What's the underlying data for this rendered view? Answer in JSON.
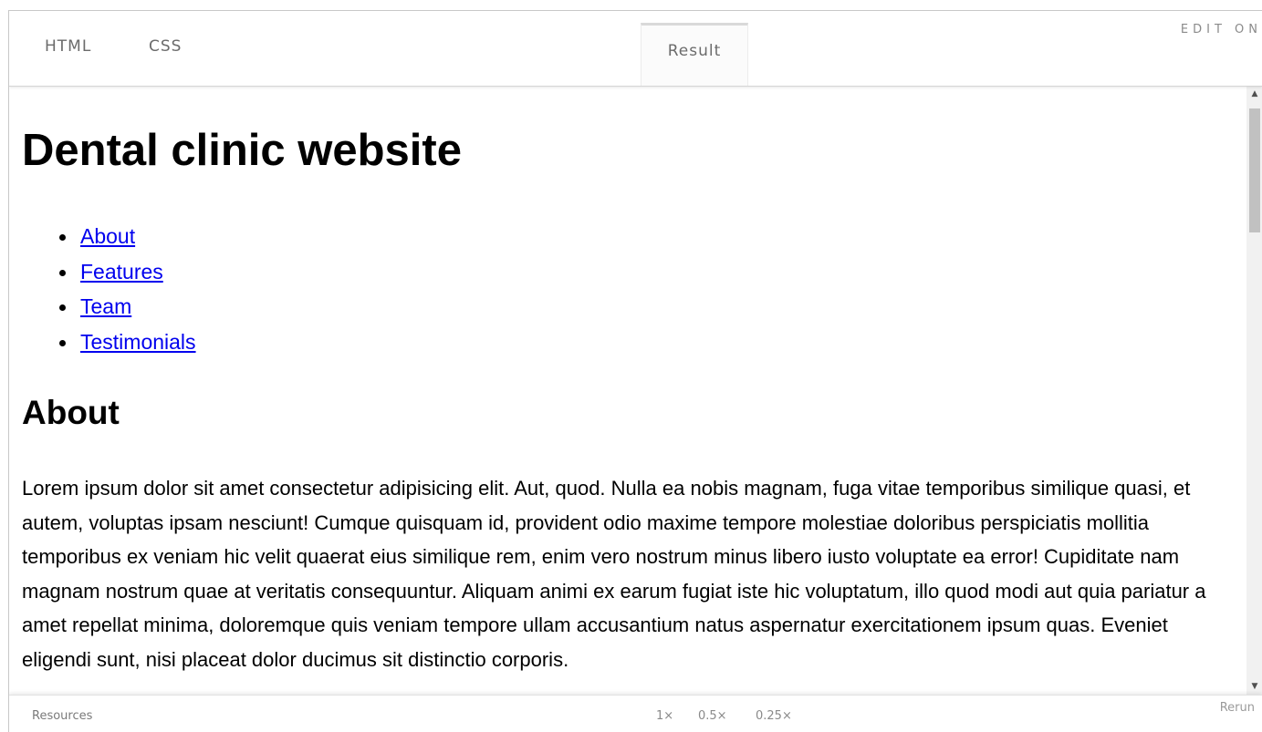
{
  "tabs": {
    "html_label": "HTML",
    "css_label": "CSS",
    "result_label": "Result"
  },
  "edit_on_label": "EDIT ON",
  "result_page": {
    "title": "Dental clinic website",
    "nav_items": [
      {
        "label": "About"
      },
      {
        "label": "Features"
      },
      {
        "label": "Team"
      },
      {
        "label": "Testimonials"
      }
    ],
    "about_heading": "About",
    "about_text": "Lorem ipsum dolor sit amet consectetur adipisicing elit. Aut, quod. Nulla ea nobis magnam, fuga vitae temporibus similique quasi, et autem, voluptas ipsam nesciunt! Cumque quisquam id, provident odio maxime tempore molestiae doloribus perspiciatis mollitia temporibus ex veniam hic velit quaerat eius similique rem, enim vero nostrum minus libero iusto voluptate ea error! Cupiditate nam magnam nostrum quae at veritatis consequuntur. Aliquam animi ex earum fugiat iste hic voluptatum, illo quod modi aut quia pariatur a amet repellat minima, doloremque quis veniam tempore ullam accusantium natus aspernatur exercitationem ipsum quas. Eveniet eligendi sunt, nisi placeat dolor ducimus sit distinctio corporis."
  },
  "bottom_bar": {
    "resources_label": "Resources",
    "zoom_options": [
      "1×",
      "0.5×",
      "0.25×"
    ],
    "rerun_label": "Rerun"
  },
  "colors": {
    "link": "#0000ee",
    "tab_text": "#6b6b6b",
    "scroll_thumb": "#c1c1c1"
  },
  "icons": {
    "scroll_up": "scroll-up-arrow-icon",
    "scroll_down": "scroll-down-arrow-icon"
  }
}
